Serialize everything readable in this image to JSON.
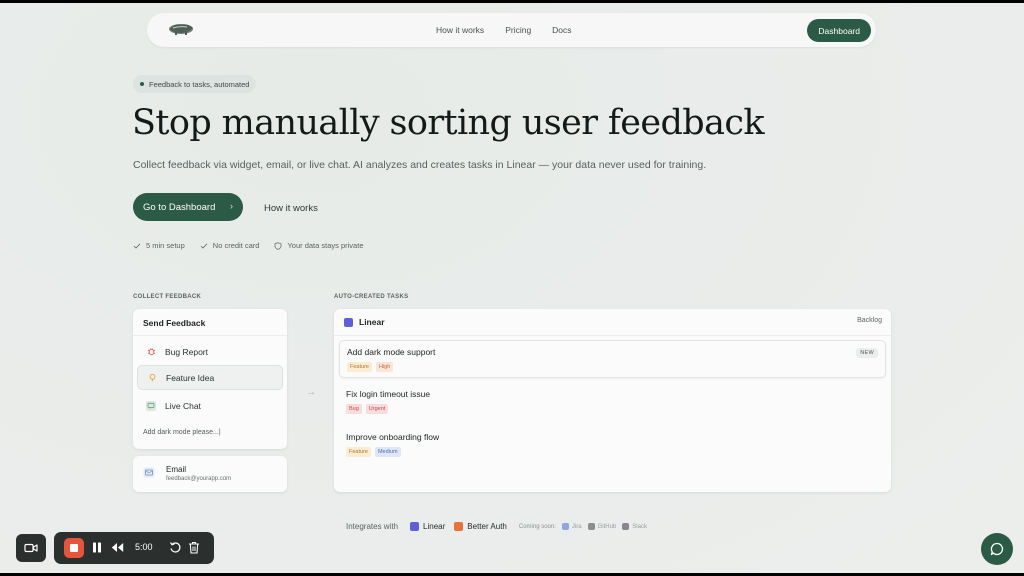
{
  "nav": {
    "links": [
      "How it works",
      "Pricing",
      "Docs"
    ],
    "dashboard_label": "Dashboard"
  },
  "hero": {
    "pill": "Feedback to tasks, automated",
    "title": "Stop manually sorting user feedback",
    "subtitle": "Collect feedback via widget, email, or live chat. AI analyzes and creates tasks in Linear — your data never used for training.",
    "cta_primary": "Go to Dashboard",
    "cta_secondary": "How it works",
    "checks": [
      "5 min setup",
      "No credit card",
      "Your data stays private"
    ]
  },
  "collect": {
    "section_label": "COLLECT FEEDBACK",
    "card_title": "Send Feedback",
    "options": [
      {
        "label": "Bug Report",
        "icon": "bug-icon"
      },
      {
        "label": "Feature Idea",
        "icon": "lightbulb-icon"
      },
      {
        "label": "Live Chat",
        "icon": "chat-icon"
      }
    ],
    "selected_option": "Feature Idea",
    "input_text": "Add dark mode please...|",
    "email": {
      "title": "Email",
      "address": "feedback@yourapp.com"
    }
  },
  "tasks": {
    "section_label": "AUTO-CREATED TASKS",
    "app_name": "Linear",
    "status": "Backlog",
    "items": [
      {
        "title": "Add dark mode support",
        "tags": [
          "Feature",
          "High"
        ],
        "badge": "NEW"
      },
      {
        "title": "Fix login timeout issue",
        "tags": [
          "Bug",
          "Urgent"
        ]
      },
      {
        "title": "Improve onboarding flow",
        "tags": [
          "Feature",
          "Medium"
        ]
      }
    ]
  },
  "integrations": {
    "label": "Integrates with",
    "active": [
      {
        "name": "Linear",
        "color": "#5f5fd8"
      },
      {
        "name": "Better Auth",
        "color": "#e8733a"
      }
    ],
    "coming_soon_label": "Coming soon:",
    "coming_soon": [
      {
        "name": "Jira",
        "color": "#8fa6e0"
      },
      {
        "name": "GitHub",
        "color": "#8a8f8d"
      },
      {
        "name": "Slack",
        "color": "#8c8590"
      }
    ]
  },
  "recorder": {
    "time": "5:00"
  },
  "colors": {
    "brand": "#2b5a47",
    "record": "#e4553b"
  }
}
